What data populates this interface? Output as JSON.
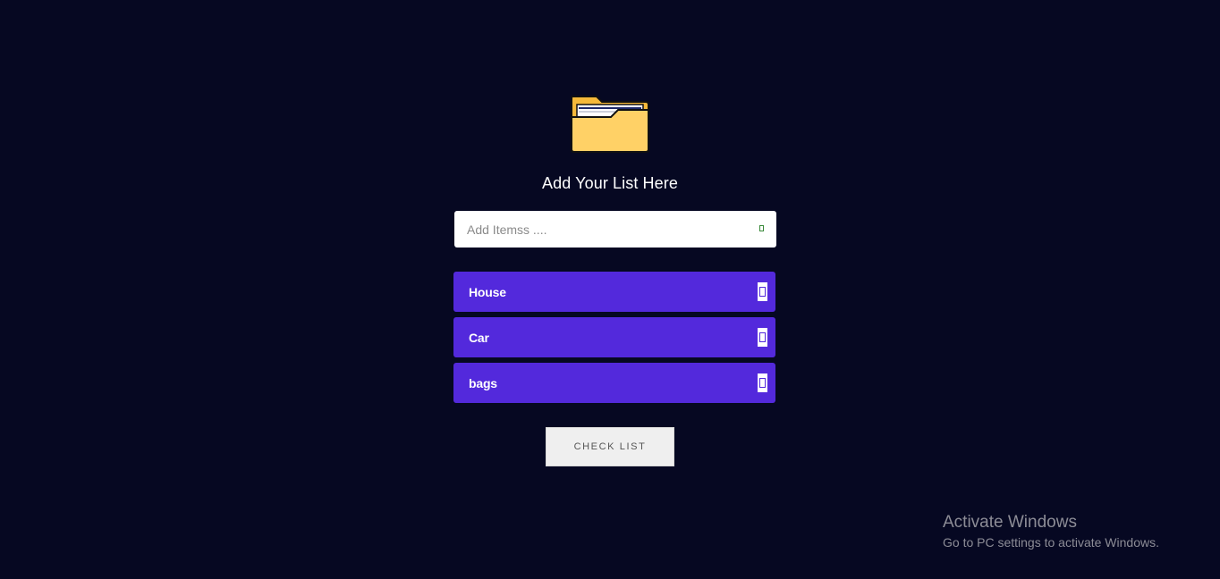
{
  "app": {
    "heading": "Add Your List Here",
    "icon": "folder-icon",
    "accent_color": "#5329dc",
    "background_color": "#060822"
  },
  "input": {
    "placeholder": "Add Itemss ....",
    "value": "",
    "add_icon": "add-icon"
  },
  "items": [
    {
      "label": "House",
      "delete_icon": "trash-icon"
    },
    {
      "label": "Car",
      "delete_icon": "trash-icon"
    },
    {
      "label": "bags",
      "delete_icon": "trash-icon"
    }
  ],
  "check_button": {
    "label": "CHECK LIST"
  },
  "watermark": {
    "title": "Activate Windows",
    "subtitle": "Go to PC settings to activate Windows."
  }
}
